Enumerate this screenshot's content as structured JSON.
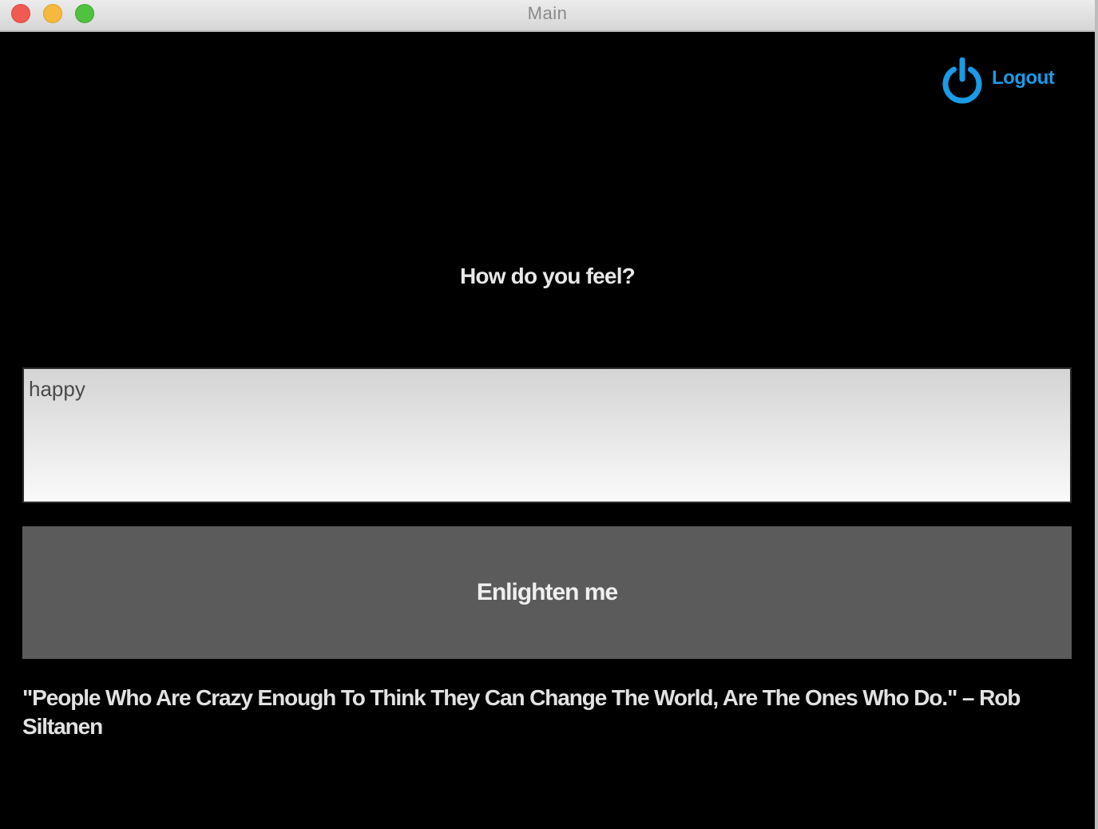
{
  "window": {
    "title": "Main"
  },
  "header": {
    "logout_label": "Logout",
    "logout_icon": "power-icon",
    "accent_color": "#1a9be8"
  },
  "main": {
    "question": "How do you feel?",
    "feel_input_value": "happy",
    "enlighten_label": "Enlighten me",
    "quote": "\"People Who Are Crazy Enough To Think They Can Change The World, Are The Ones Who Do.\" – Rob Siltanen"
  },
  "colors": {
    "background": "#000000",
    "button_background": "#5b5b5b",
    "text": "#e8e8e8"
  }
}
